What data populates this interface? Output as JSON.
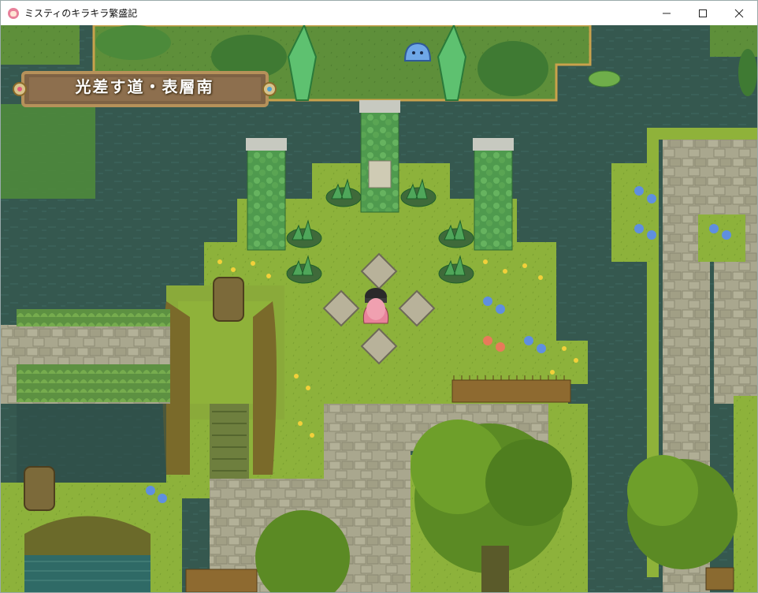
{
  "window": {
    "title": "ミスティのキラキラ繁盛記",
    "controls": [
      "minimize",
      "maximize",
      "close"
    ]
  },
  "map": {
    "name": "光差す道・表層南"
  },
  "colors": {
    "water": "#35584f",
    "grass": "#8fb23a",
    "stone_path": "#a6a48a",
    "banner_frame": "#b6915a"
  },
  "icons": [
    "app-icon",
    "minimize-icon",
    "maximize-icon",
    "close-icon"
  ]
}
